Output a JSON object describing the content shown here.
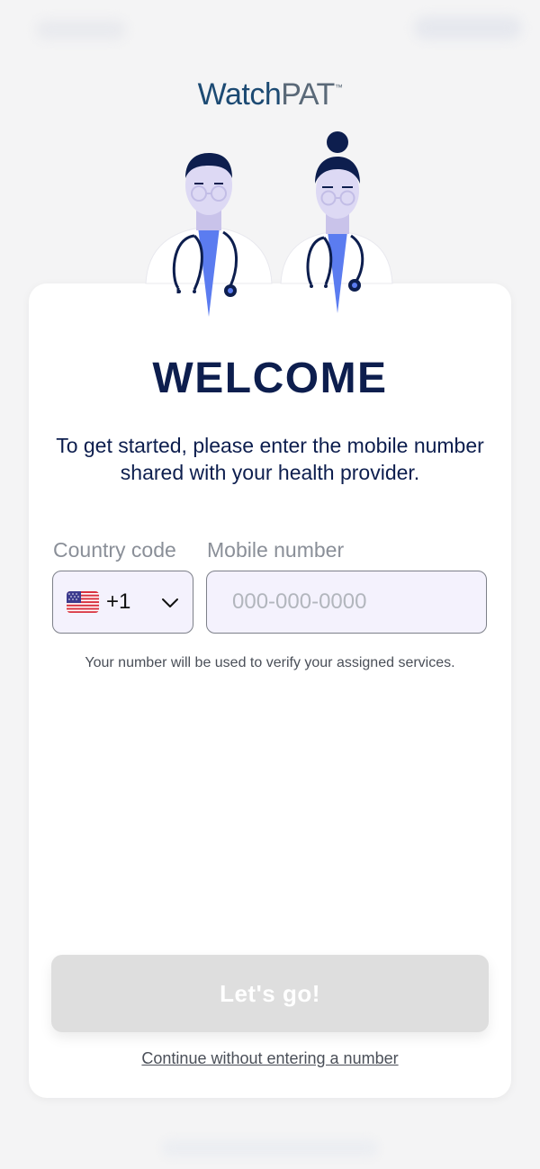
{
  "brand": {
    "logo_watch": "Watch",
    "logo_pat": "PAT",
    "logo_tm": "™"
  },
  "welcome": {
    "title": "WELCOME",
    "subtitle": "To get started, please enter the mobile number shared with your health provider."
  },
  "form": {
    "country_label": "Country code",
    "mobile_label": "Mobile number",
    "country_flag_icon": "us-flag-icon",
    "country_code": "+1",
    "mobile_value": "",
    "mobile_placeholder": "000-000-0000",
    "helper_text": "Your number will be used to verify your assigned services."
  },
  "actions": {
    "primary_label": "Let's go!",
    "skip_label": "Continue without entering a number"
  },
  "colors": {
    "navy": "#0d1e4e",
    "logo_blue": "#1c4a73",
    "scrub_blue": "#5b7cf0",
    "disabled_button": "#dedede",
    "input_bg": "#f4f2fd"
  }
}
